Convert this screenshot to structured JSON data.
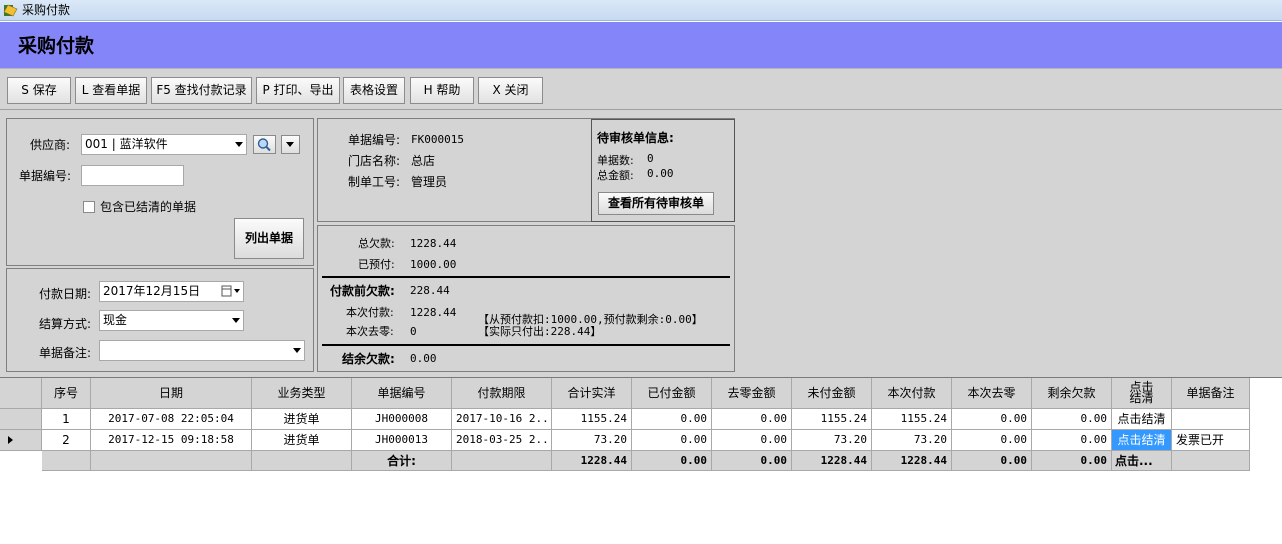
{
  "window": {
    "title": "采购付款"
  },
  "header": {
    "title": "采购付款"
  },
  "toolbar": {
    "save": "S 保存",
    "view_order": "L 查看单据",
    "find_records": "F5 查找付款记录",
    "print_export": "P 打印、导出",
    "table_settings": "表格设置",
    "help": "H 帮助",
    "close": "X 关闭"
  },
  "filter": {
    "supplier_label": "供应商:",
    "supplier_value": "001 | 蓝洋软件",
    "order_no_label": "单据编号:",
    "order_no_value": "",
    "include_cleared_label": "包含已结清的单据",
    "include_cleared_checked": false,
    "list_button": "列出单据"
  },
  "payment": {
    "date_label": "付款日期:",
    "date_value": "2017年12月15日",
    "method_label": "结算方式:",
    "method_value": "现金",
    "remark_label": "单据备注:",
    "remark_value": ""
  },
  "order_info": {
    "no_label": "单据编号:",
    "no_value": "FK000015",
    "store_label": "门店名称:",
    "store_value": "总店",
    "operator_label": "制单工号:",
    "operator_value": "管理员"
  },
  "pending": {
    "title": "待审核单信息:",
    "count_label": "单据数:",
    "count_value": "0",
    "amount_label": "总金额:",
    "amount_value": "0.00",
    "view_button": "查看所有待审核单"
  },
  "summary": {
    "total_debt_label": "总欠款:",
    "total_debt_value": "1228.44",
    "prepaid_label": "已预付:",
    "prepaid_value": "1000.00",
    "before_label": "付款前欠款:",
    "before_value": "228.44",
    "this_pay_label": "本次付款:",
    "this_pay_value": "1228.44",
    "round_off_label": "本次去零:",
    "round_off_value": "0",
    "note_line1": "【从预付款扣:1000.00,预付款剩余:0.00】",
    "note_line2": "【实际只付出:228.44】",
    "remaining_label": "结余欠款:",
    "remaining_value": "0.00"
  },
  "grid": {
    "columns": [
      "序号",
      "日期",
      "业务类型",
      "单据编号",
      "付款期限",
      "合计实洋",
      "已付金额",
      "去零金额",
      "未付金额",
      "本次付款",
      "本次去零",
      "剩余欠款",
      "点击\n结清",
      "单据备注"
    ],
    "rows": [
      [
        "1",
        "2017-07-08 22:05:04",
        "进货单",
        "JH000008",
        "2017-10-16 2...",
        "1155.24",
        "0.00",
        "0.00",
        "1155.24",
        "1155.24",
        "0.00",
        "0.00",
        "点击结清",
        ""
      ],
      [
        "2",
        "2017-12-15 09:18:58",
        "进货单",
        "JH000013",
        "2018-03-25 2...",
        "73.20",
        "0.00",
        "0.00",
        "73.20",
        "73.20",
        "0.00",
        "0.00",
        "点击结清",
        "发票已开"
      ]
    ],
    "totals": [
      "",
      "",
      "",
      "合计:",
      "",
      "1228.44",
      "0.00",
      "0.00",
      "1228.44",
      "1228.44",
      "0.00",
      "0.00",
      "点击...",
      ""
    ]
  },
  "colors": {
    "banner": "#8585fa",
    "panel": "#d4d4d4",
    "selection": "#3399ff"
  }
}
